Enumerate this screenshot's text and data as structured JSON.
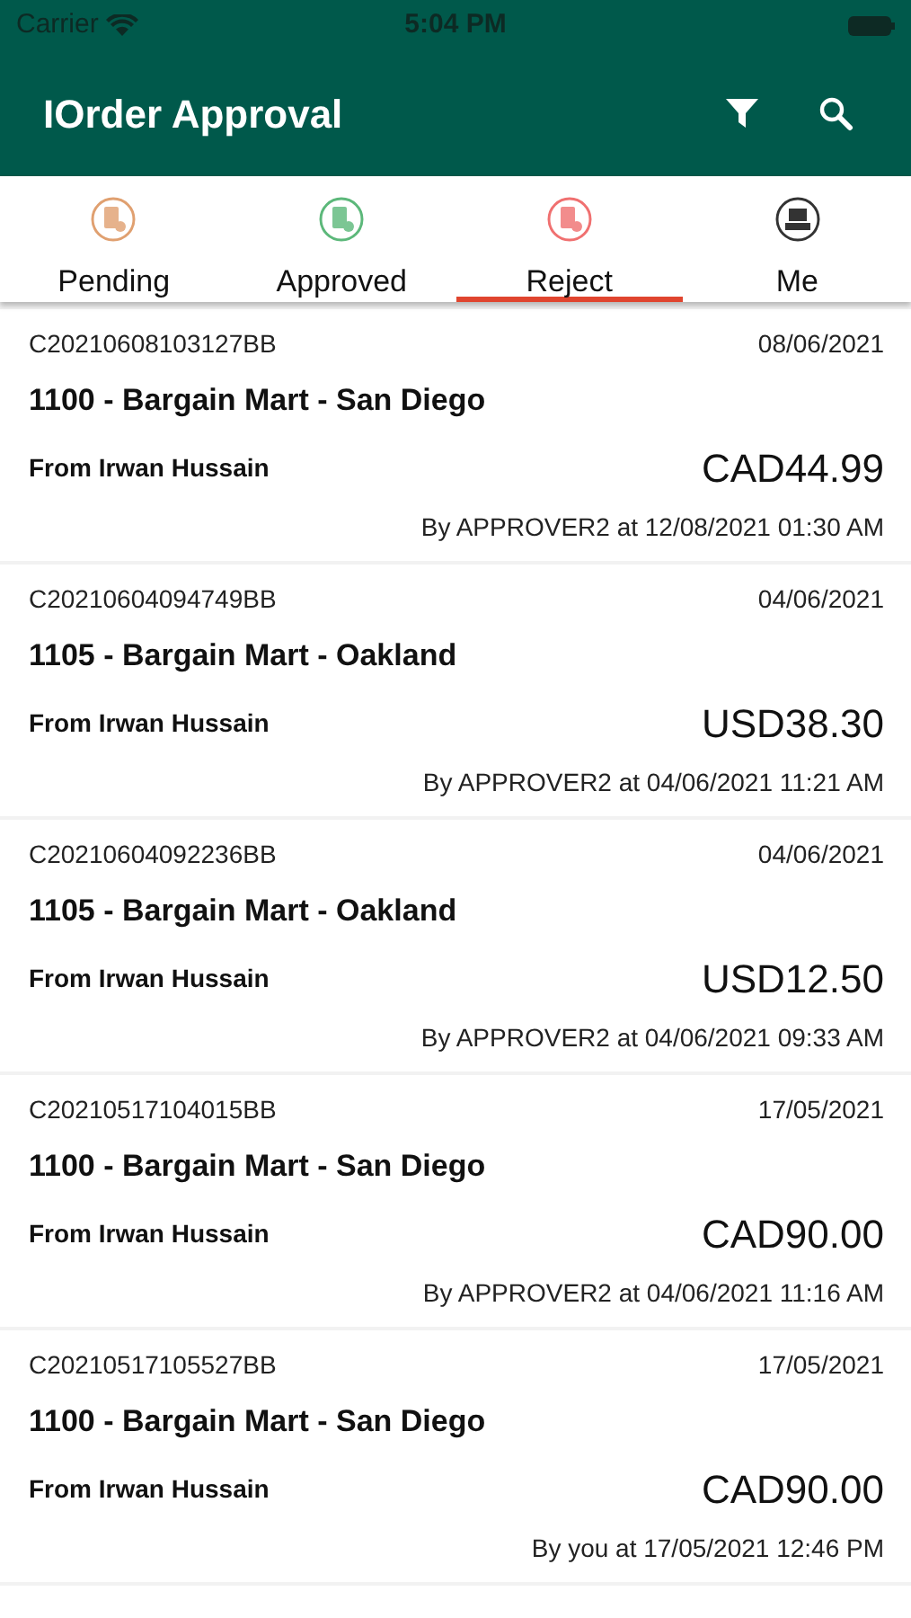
{
  "status_bar": {
    "carrier": "Carrier",
    "time": "5:04 PM"
  },
  "app_bar": {
    "title": "IOrder Approval"
  },
  "tabs": [
    {
      "label": "Pending",
      "kind": "pending",
      "selected": false
    },
    {
      "label": "Approved",
      "kind": "approved",
      "selected": false
    },
    {
      "label": "Reject",
      "kind": "reject",
      "selected": true
    },
    {
      "label": "Me",
      "kind": "me",
      "selected": false
    }
  ],
  "orders": [
    {
      "code": "C20210608103127BB",
      "date": "08/06/2021",
      "store": "1100 - Bargain Mart - San Diego",
      "from": "From Irwan Hussain",
      "amount": "CAD44.99",
      "by": "By APPROVER2 at 12/08/2021 01:30 AM"
    },
    {
      "code": "C20210604094749BB",
      "date": "04/06/2021",
      "store": "1105 - Bargain Mart - Oakland",
      "from": "From Irwan Hussain",
      "amount": "USD38.30",
      "by": "By APPROVER2 at 04/06/2021 11:21 AM"
    },
    {
      "code": "C20210604092236BB",
      "date": "04/06/2021",
      "store": "1105 - Bargain Mart - Oakland",
      "from": "From Irwan Hussain",
      "amount": "USD12.50",
      "by": "By APPROVER2 at 04/06/2021 09:33 AM"
    },
    {
      "code": "C20210517104015BB",
      "date": "17/05/2021",
      "store": "1100 - Bargain Mart - San Diego",
      "from": "From Irwan Hussain",
      "amount": "CAD90.00",
      "by": "By APPROVER2 at 04/06/2021 11:16 AM"
    },
    {
      "code": "C20210517105527BB",
      "date": "17/05/2021",
      "store": "1100 - Bargain Mart - San Diego",
      "from": "From Irwan Hussain",
      "amount": "CAD90.00",
      "by": "By you at 17/05/2021 12:46 PM"
    }
  ]
}
